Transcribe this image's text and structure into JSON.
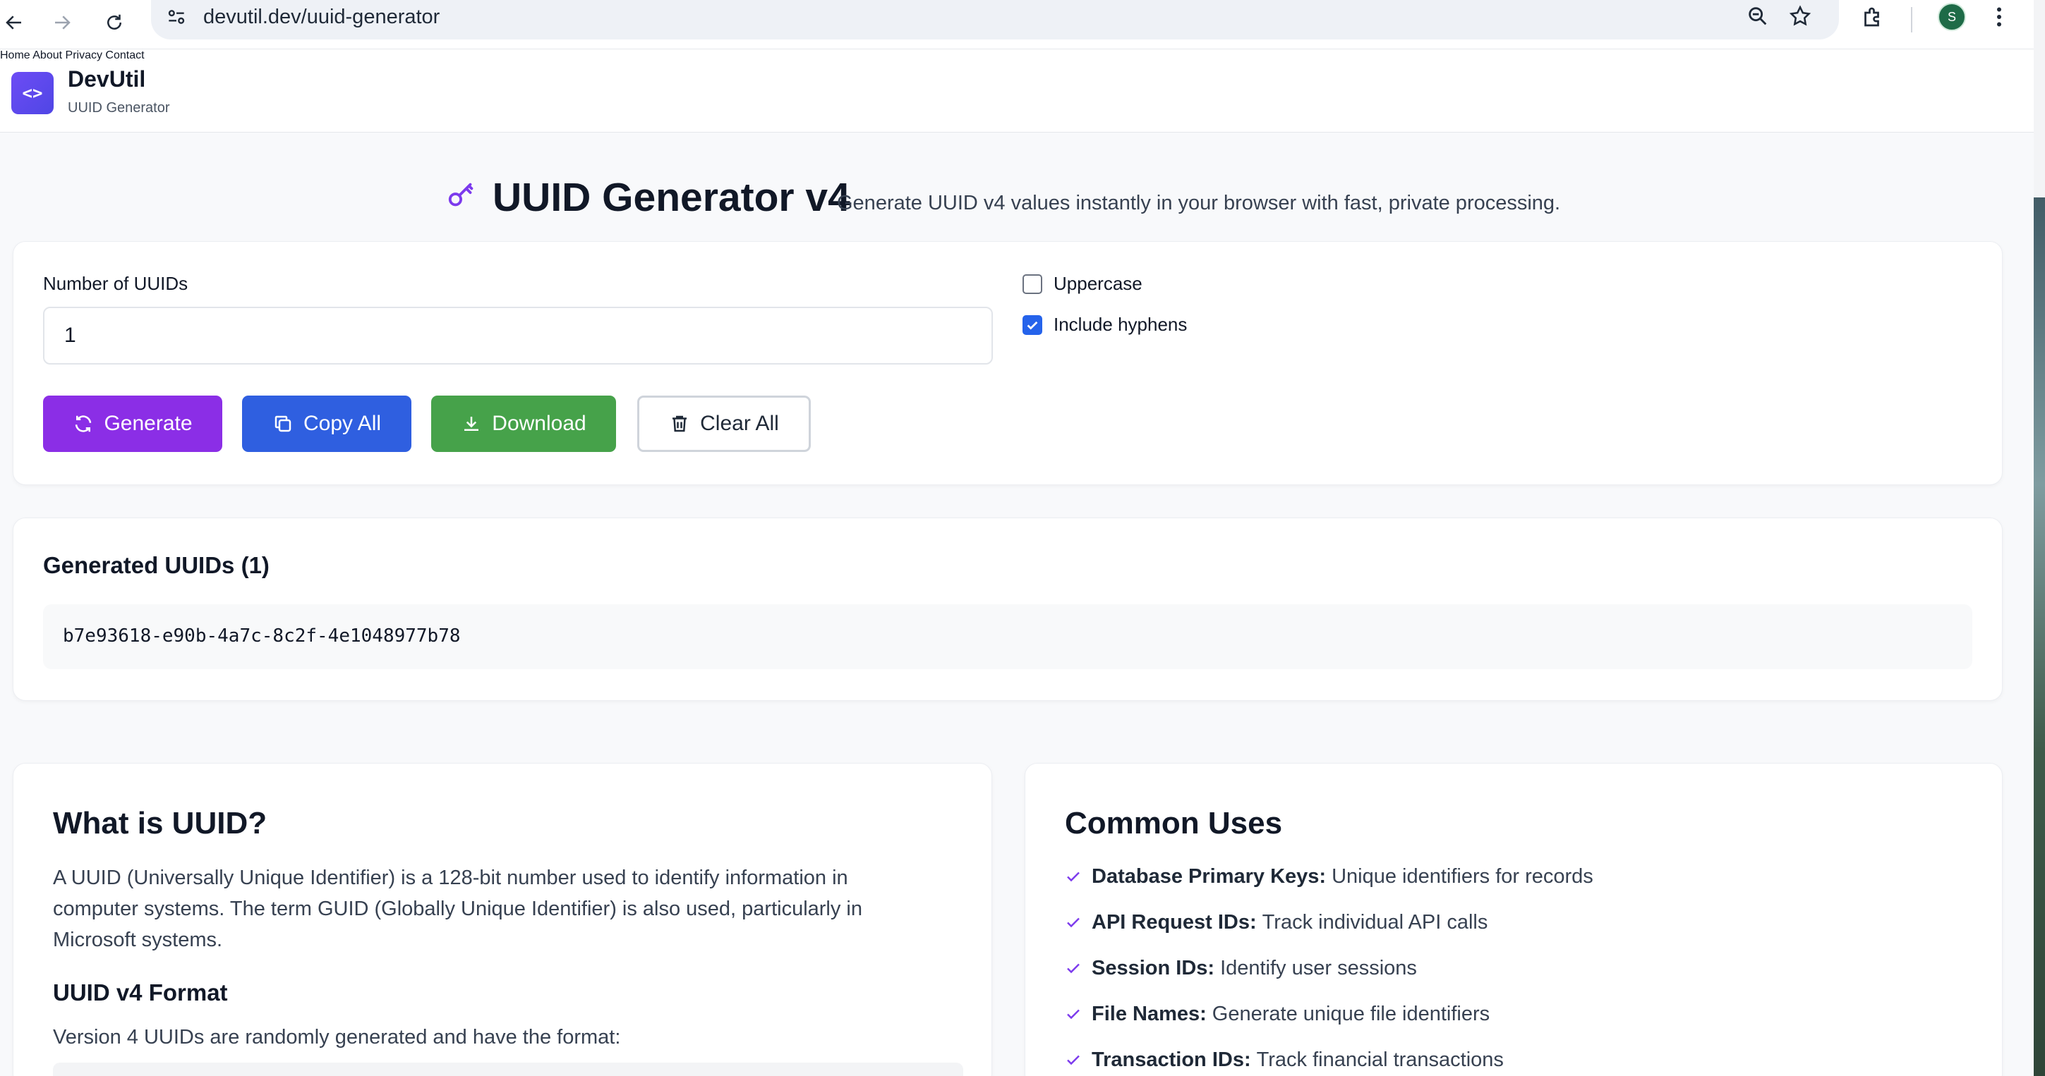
{
  "browser": {
    "url": "devutil.dev/uuid-generator",
    "profile_initial": "S"
  },
  "site": {
    "logo_glyph": "<>",
    "brand": "DevUtil",
    "subtitle": "UUID Generator",
    "nav": [
      "Home",
      "About",
      "Privacy",
      "Contact"
    ]
  },
  "hero": {
    "title": "UUID Generator v4",
    "description": "Generate UUID v4 values instantly in your browser with fast, private processing.",
    "icon": "key-icon"
  },
  "controls": {
    "count_label": "Number of UUIDs",
    "count_value": "1",
    "uppercase_label": "Uppercase",
    "uppercase_checked": false,
    "hyphens_label": "Include hyphens",
    "hyphens_checked": true,
    "buttons": {
      "generate": "Generate",
      "copy_all": "Copy All",
      "download": "Download",
      "clear_all": "Clear All"
    }
  },
  "output": {
    "title": "Generated UUIDs (1)",
    "uuids": [
      "b7e93618-e90b-4a7c-8c2f-4e1048977b78"
    ]
  },
  "about": {
    "title": "What is UUID?",
    "body": "A UUID (Universally Unique Identifier) is a 128-bit number used to identify information in computer systems. The term GUID (Globally Unique Identifier) is also used, particularly in Microsoft systems.",
    "format_title": "UUID v4 Format",
    "format_body": "Version 4 UUIDs are randomly generated and have the format:"
  },
  "uses": {
    "title": "Common Uses",
    "items": [
      {
        "term": "Database Primary Keys:",
        "desc": "Unique identifiers for records"
      },
      {
        "term": "API Request IDs:",
        "desc": "Track individual API calls"
      },
      {
        "term": "Session IDs:",
        "desc": "Identify user sessions"
      },
      {
        "term": "File Names:",
        "desc": "Generate unique file identifiers"
      },
      {
        "term": "Transaction IDs:",
        "desc": "Track financial transactions"
      }
    ]
  },
  "colors": {
    "generate": "#8b2ee6",
    "copy": "#2f5fe0",
    "download": "#46a24a",
    "accent_purple": "#7c3aed",
    "checkbox": "#2563eb"
  }
}
